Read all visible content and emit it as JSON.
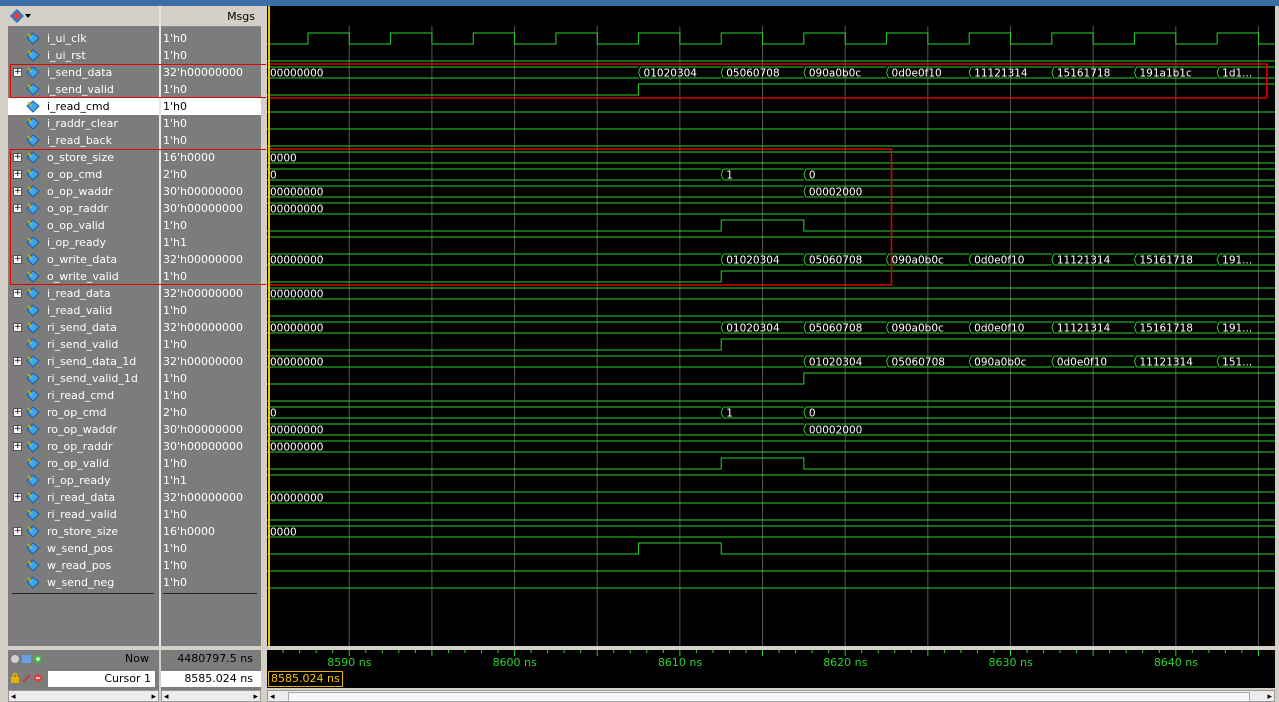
{
  "header": {
    "msgs_label": "Msgs"
  },
  "signals": [
    {
      "name": "i_ui_clk",
      "value": "1'h0",
      "expandable": false
    },
    {
      "name": "i_ui_rst",
      "value": "1'h0",
      "expandable": false
    },
    {
      "name": "i_send_data",
      "value": "32'h00000000",
      "expandable": true
    },
    {
      "name": "i_send_valid",
      "value": "1'h0",
      "expandable": false
    },
    {
      "name": "i_read_cmd",
      "value": "1'h0",
      "expandable": false,
      "selected": true
    },
    {
      "name": "i_raddr_clear",
      "value": "1'h0",
      "expandable": false
    },
    {
      "name": "i_read_back",
      "value": "1'h0",
      "expandable": false
    },
    {
      "name": "o_store_size",
      "value": "16'h0000",
      "expandable": true
    },
    {
      "name": "o_op_cmd",
      "value": "2'h0",
      "expandable": true
    },
    {
      "name": "o_op_waddr",
      "value": "30'h00000000",
      "expandable": true
    },
    {
      "name": "o_op_raddr",
      "value": "30'h00000000",
      "expandable": true
    },
    {
      "name": "o_op_valid",
      "value": "1'h0",
      "expandable": false
    },
    {
      "name": "i_op_ready",
      "value": "1'h1",
      "expandable": false
    },
    {
      "name": "o_write_data",
      "value": "32'h00000000",
      "expandable": true
    },
    {
      "name": "o_write_valid",
      "value": "1'h0",
      "expandable": false
    },
    {
      "name": "i_read_data",
      "value": "32'h00000000",
      "expandable": true
    },
    {
      "name": "i_read_valid",
      "value": "1'h0",
      "expandable": false
    },
    {
      "name": "ri_send_data",
      "value": "32'h00000000",
      "expandable": true
    },
    {
      "name": "ri_send_valid",
      "value": "1'h0",
      "expandable": false
    },
    {
      "name": "ri_send_data_1d",
      "value": "32'h00000000",
      "expandable": true
    },
    {
      "name": "ri_send_valid_1d",
      "value": "1'h0",
      "expandable": false
    },
    {
      "name": "ri_read_cmd",
      "value": "1'h0",
      "expandable": false
    },
    {
      "name": "ro_op_cmd",
      "value": "2'h0",
      "expandable": true
    },
    {
      "name": "ro_op_waddr",
      "value": "30'h00000000",
      "expandable": true
    },
    {
      "name": "ro_op_raddr",
      "value": "30'h00000000",
      "expandable": true
    },
    {
      "name": "ro_op_valid",
      "value": "1'h0",
      "expandable": false
    },
    {
      "name": "ri_op_ready",
      "value": "1'h1",
      "expandable": false
    },
    {
      "name": "ri_read_data",
      "value": "32'h00000000",
      "expandable": true
    },
    {
      "name": "ri_read_valid",
      "value": "1'h0",
      "expandable": false
    },
    {
      "name": "ro_store_size",
      "value": "16'h0000",
      "expandable": true
    },
    {
      "name": "w_send_pos",
      "value": "1'h0",
      "expandable": false
    },
    {
      "name": "w_read_pos",
      "value": "1'h0",
      "expandable": false
    },
    {
      "name": "w_send_neg",
      "value": "1'h0",
      "expandable": false
    }
  ],
  "waves": {
    "time_start_ns": 8585.024,
    "time_end_ns": 8646.0,
    "clock_period_ns": 5,
    "clock_first_rise_ns": 8587.5,
    "clock_rows": [
      0
    ],
    "bits": {
      "1": [
        [
          8585,
          0
        ]
      ],
      "3": [
        [
          8585,
          0
        ],
        [
          8607.5,
          1
        ]
      ],
      "4": [
        [
          8585,
          0
        ]
      ],
      "5": [
        [
          8585,
          0
        ]
      ],
      "6": [
        [
          8585,
          0
        ]
      ],
      "11": [
        [
          8585,
          0
        ],
        [
          8612.5,
          1
        ],
        [
          8617.5,
          0
        ]
      ],
      "12": [
        [
          8585,
          1
        ]
      ],
      "14": [
        [
          8585,
          0
        ],
        [
          8612.5,
          1
        ]
      ],
      "16": [
        [
          8585,
          0
        ]
      ],
      "18": [
        [
          8585,
          0
        ],
        [
          8612.5,
          1
        ]
      ],
      "20": [
        [
          8585,
          0
        ],
        [
          8617.5,
          1
        ]
      ],
      "21": [
        [
          8585,
          0
        ]
      ],
      "25": [
        [
          8585,
          0
        ],
        [
          8612.5,
          1
        ],
        [
          8617.5,
          0
        ]
      ],
      "26": [
        [
          8585,
          1
        ]
      ],
      "28": [
        [
          8585,
          0
        ]
      ],
      "30": [
        [
          8585,
          0
        ],
        [
          8607.5,
          1
        ],
        [
          8612.5,
          0
        ]
      ],
      "31": [
        [
          8585,
          0
        ]
      ],
      "32": [
        [
          8585,
          0
        ]
      ]
    },
    "buses": {
      "2": [
        [
          8585,
          "00000000"
        ],
        [
          8607.5,
          "01020304"
        ],
        [
          8612.5,
          "05060708"
        ],
        [
          8617.5,
          "090a0b0c"
        ],
        [
          8622.5,
          "0d0e0f10"
        ],
        [
          8627.5,
          "11121314"
        ],
        [
          8632.5,
          "15161718"
        ],
        [
          8637.5,
          "191a1b1c"
        ],
        [
          8642.5,
          "1d1..."
        ]
      ],
      "7": [
        [
          8585,
          "0000"
        ]
      ],
      "8": [
        [
          8585,
          "0"
        ],
        [
          8612.5,
          "1"
        ],
        [
          8617.5,
          "0"
        ]
      ],
      "9": [
        [
          8585,
          "00000000"
        ],
        [
          8617.5,
          "00002000"
        ]
      ],
      "10": [
        [
          8585,
          "00000000"
        ]
      ],
      "13": [
        [
          8585,
          "00000000"
        ],
        [
          8612.5,
          "01020304"
        ],
        [
          8617.5,
          "05060708"
        ],
        [
          8622.5,
          "090a0b0c"
        ],
        [
          8627.5,
          "0d0e0f10"
        ],
        [
          8632.5,
          "11121314"
        ],
        [
          8637.5,
          "15161718"
        ],
        [
          8642.5,
          "191..."
        ]
      ],
      "15": [
        [
          8585,
          "00000000"
        ]
      ],
      "17": [
        [
          8585,
          "00000000"
        ],
        [
          8612.5,
          "01020304"
        ],
        [
          8617.5,
          "05060708"
        ],
        [
          8622.5,
          "090a0b0c"
        ],
        [
          8627.5,
          "0d0e0f10"
        ],
        [
          8632.5,
          "11121314"
        ],
        [
          8637.5,
          "15161718"
        ],
        [
          8642.5,
          "191..."
        ]
      ],
      "19": [
        [
          8585,
          "00000000"
        ],
        [
          8617.5,
          "01020304"
        ],
        [
          8622.5,
          "05060708"
        ],
        [
          8627.5,
          "090a0b0c"
        ],
        [
          8632.5,
          "0d0e0f10"
        ],
        [
          8637.5,
          "11121314"
        ],
        [
          8642.5,
          "151..."
        ]
      ],
      "22": [
        [
          8585,
          "0"
        ],
        [
          8612.5,
          "1"
        ],
        [
          8617.5,
          "0"
        ]
      ],
      "23": [
        [
          8585,
          "00000000"
        ],
        [
          8617.5,
          "00002000"
        ]
      ],
      "24": [
        [
          8585,
          "00000000"
        ]
      ],
      "27": [
        [
          8585,
          "00000000"
        ]
      ],
      "29": [
        [
          8585,
          "0000"
        ]
      ]
    },
    "highlight_boxes": [
      {
        "rows": [
          2,
          3
        ],
        "from_ns": 8585.024,
        "to_ns": 8645.5
      },
      {
        "rows": [
          7,
          14
        ],
        "from_ns": 8585.024,
        "to_ns": 8622.8
      }
    ],
    "colors": {
      "wave": "#2bd32b",
      "grid": "#555555",
      "cursor": "#f5c400",
      "highlight": "#e00000",
      "background": "#000000"
    }
  },
  "timeline": {
    "labels": [
      "8590 ns",
      "8600 ns",
      "8610 ns",
      "8620 ns",
      "8630 ns",
      "8640 ns"
    ],
    "label_times_ns": [
      8590,
      8600,
      8610,
      8620,
      8630,
      8640
    ]
  },
  "status": {
    "now_label": "Now",
    "now_value": "4480797.5 ns",
    "cursor_name": "Cursor 1",
    "cursor_value": "8585.024 ns",
    "cursor_time_label": "8585.024 ns"
  }
}
